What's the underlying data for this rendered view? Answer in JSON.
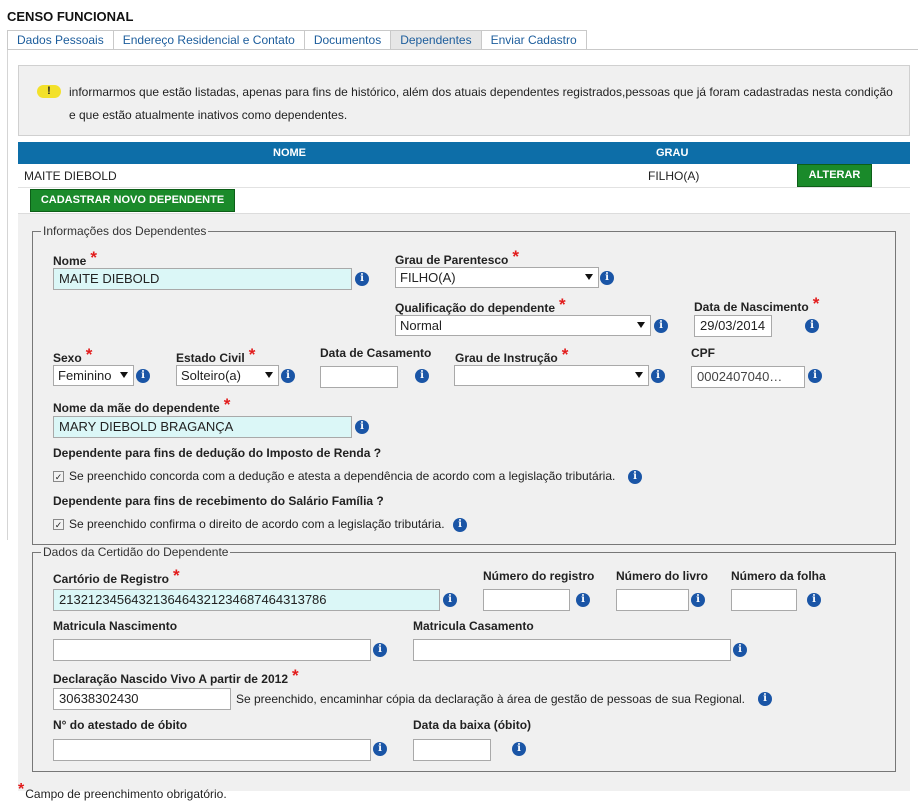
{
  "page_title": "CENSO FUNCIONAL",
  "tabs": [
    "Dados Pessoais",
    "Endereço Residencial e Contato",
    "Documentos",
    "Dependentes",
    "Enviar Cadastro"
  ],
  "active_tab": "Dependentes",
  "notice": {
    "icon": "warning-icon",
    "icon_glyph": "!",
    "text": "informarmos que estão listadas, apenas para fins de histórico, além dos atuais dependentes registrados,pessoas que já foram cadastradas nesta condição e que estão atualmente inativos como dependentes."
  },
  "dependents_table": {
    "headers": {
      "nome": "NOME",
      "grau": "GRAU"
    },
    "rows": [
      {
        "nome": "MAITE DIEBOLD",
        "grau": "FILHO(A)",
        "action": "ALTERAR"
      }
    ]
  },
  "new_dependent_button": "CADASTRAR NOVO DEPENDENTE",
  "info_dependentes": {
    "legend": "Informações dos Dependentes",
    "nome": {
      "label": "Nome",
      "value": "MAITE DIEBOLD"
    },
    "grau_parentesco": {
      "label": "Grau de Parentesco",
      "value": "FILHO(A)"
    },
    "qualificacao": {
      "label": "Qualificação do dependente",
      "value": "Normal"
    },
    "data_nascimento": {
      "label": "Data de Nascimento",
      "value": "29/03/2014"
    },
    "sexo": {
      "label": "Sexo",
      "value": "Feminino"
    },
    "estado_civil": {
      "label": "Estado Civil",
      "value": "Solteiro(a)"
    },
    "data_casamento": {
      "label": "Data de Casamento",
      "value": ""
    },
    "grau_instrucao": {
      "label": "Grau de Instrução",
      "value": ""
    },
    "cpf": {
      "label": "CPF",
      "value": "0002407040…"
    },
    "nome_mae": {
      "label": "Nome da mãe do dependente",
      "value": "MARY DIEBOLD BRAGANÇA"
    },
    "ir_question": "Dependente para fins de dedução do Imposto de Renda ?",
    "ir_check_text": "Se preenchido concorda com a dedução e atesta a dependência de acordo com a legislação tributária.",
    "ir_checked": true,
    "sf_question": "Dependente para fins de recebimento do Salário Família ?",
    "sf_check_text": "Se preenchido confirma o direito de acordo com a legislação tributária.",
    "sf_checked": true
  },
  "certidao": {
    "legend": "Dados da Certidão do Dependente",
    "cartorio": {
      "label": "Cartório de Registro",
      "value": "21321234564321364643212346874643​13786"
    },
    "numero_registro": {
      "label": "Número do registro",
      "value": ""
    },
    "numero_livro": {
      "label": "Número do livro",
      "value": ""
    },
    "numero_folha": {
      "label": "Número da folha",
      "value": ""
    },
    "matricula_nascimento": {
      "label": "Matricula Nascimento",
      "value": ""
    },
    "matricula_casamento": {
      "label": "Matricula Casamento",
      "value": ""
    },
    "declaracao": {
      "label": "Declaração Nascido Vivo A partir de 2012",
      "value": "30638302430",
      "hint": "Se preenchido, encaminhar cópia da declaração à área de gestão de pessoas de sua Regional."
    },
    "atestado_obito": {
      "label": "N° do atestado de óbito",
      "value": ""
    },
    "data_baixa": {
      "label": "Data da baixa (óbito)",
      "value": ""
    }
  },
  "footnote": "Campo de preenchimento obrigatório.",
  "required_marker": "*",
  "info_glyph": "i",
  "check_glyph": "✓",
  "colors": {
    "header_blue": "#0d6ea8",
    "button_green": "#1a8a2a",
    "required_red": "#e21b1b",
    "highlight_input": "#dbf7f7",
    "info_blue": "#1a55a6"
  }
}
